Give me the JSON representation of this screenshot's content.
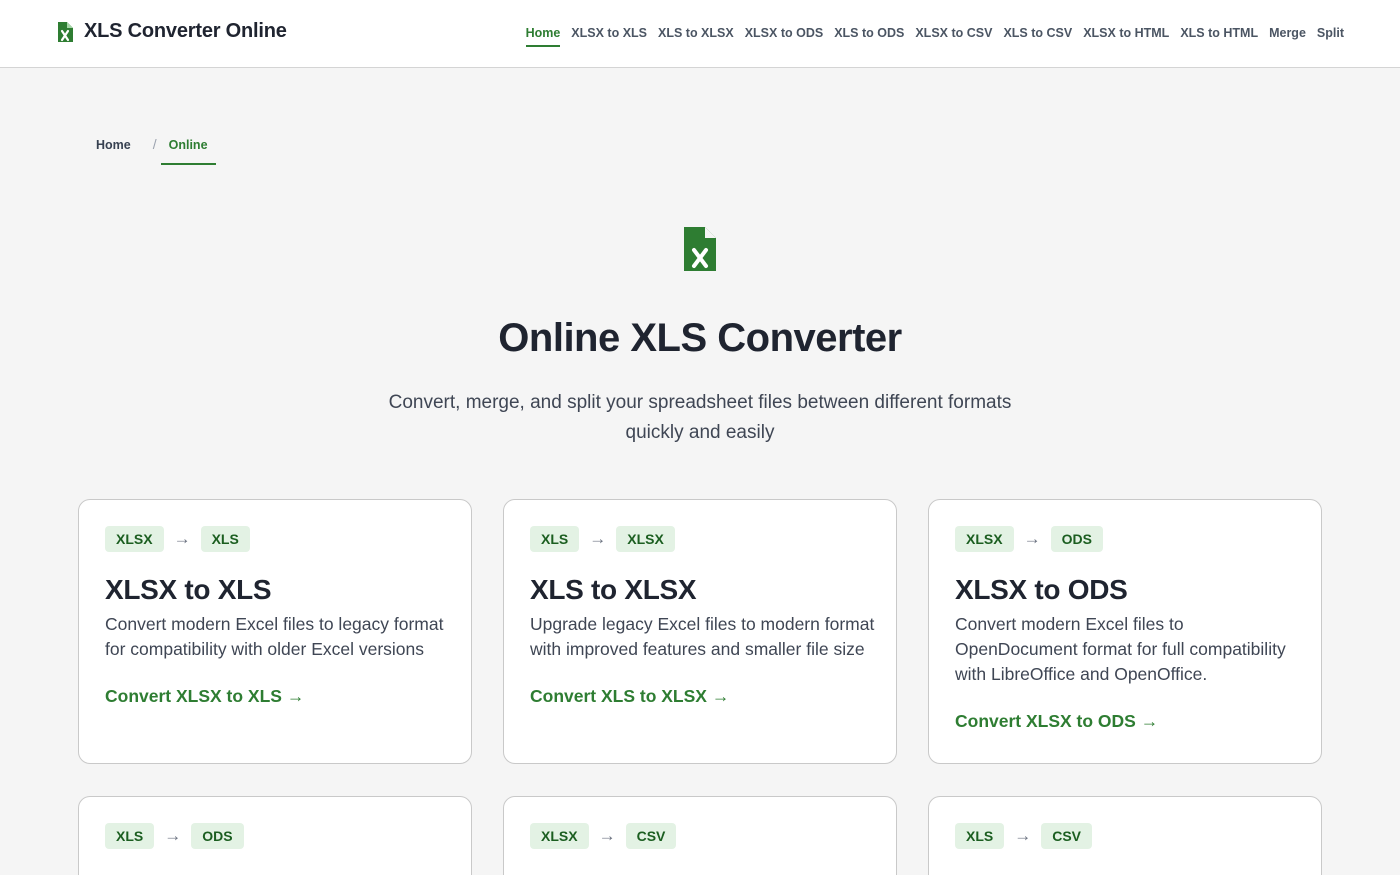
{
  "header": {
    "brand": "XLS Converter Online",
    "nav": [
      {
        "label": "Home",
        "active": true
      },
      {
        "label": "XLSX to XLS"
      },
      {
        "label": "XLS to XLSX"
      },
      {
        "label": "XLSX to ODS"
      },
      {
        "label": "XLS to ODS"
      },
      {
        "label": "XLSX to CSV"
      },
      {
        "label": "XLS to CSV"
      },
      {
        "label": "XLSX to HTML"
      },
      {
        "label": "XLS to HTML"
      },
      {
        "label": "Merge"
      },
      {
        "label": "Split"
      }
    ]
  },
  "breadcrumb": {
    "home": "Home",
    "separator": "/",
    "current": "Online"
  },
  "hero": {
    "icon": "excel-file-icon",
    "title": "Online XLS Converter",
    "subtitle": "Convert, merge, and split your spreadsheet files between different formats quickly and easily"
  },
  "colors": {
    "accent": "#2e7d32",
    "tag_bg": "#e3f2e4",
    "tag_text": "#1b5e20",
    "page_bg": "#f5f5f5"
  },
  "cards": [
    {
      "from": "XLSX",
      "to": "XLS",
      "title": "XLSX to XLS",
      "description": "Convert modern Excel files to legacy format for compatibility with older Excel versions",
      "link": "Convert XLSX to XLS →"
    },
    {
      "from": "XLS",
      "to": "XLSX",
      "title": "XLS to XLSX",
      "description": "Upgrade legacy Excel files to modern format with improved features and smaller file size",
      "link": "Convert XLS to XLSX →"
    },
    {
      "from": "XLSX",
      "to": "ODS",
      "title": "XLSX to ODS",
      "description": "Convert modern Excel files to OpenDocument format for full compatibility with LibreOffice and OpenOffice.",
      "link": "Convert XLSX to ODS →"
    },
    {
      "from": "XLS",
      "to": "ODS"
    },
    {
      "from": "XLSX",
      "to": "CSV"
    },
    {
      "from": "XLS",
      "to": "CSV"
    }
  ]
}
